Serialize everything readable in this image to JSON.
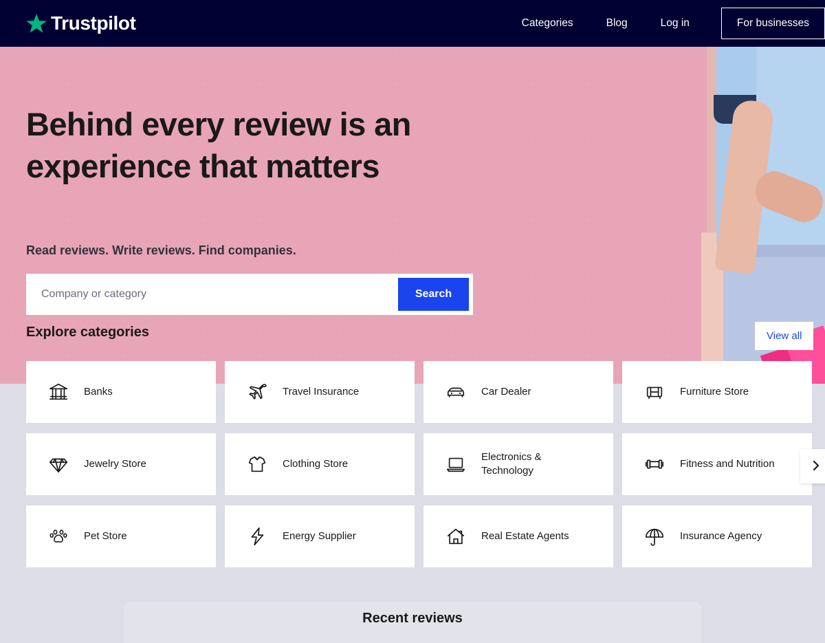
{
  "header": {
    "logo_text": "Trustpilot",
    "logo_icon": "star-icon",
    "nav_links": [
      {
        "label": "Categories",
        "name": "nav-link-categories"
      },
      {
        "label": "Blog",
        "name": "nav-link-blog"
      },
      {
        "label": "Log in",
        "name": "nav-link-login"
      }
    ],
    "business_button": "For businesses",
    "background_color": "#000032",
    "star_color": "#00b67a"
  },
  "hero": {
    "title": "Behind every review is an experience that matters",
    "subtitle": "Read reviews. Write reviews. Find companies.",
    "background_color": "#e8a5b7",
    "search": {
      "placeholder": "Company or category",
      "value": "",
      "button_label": "Search",
      "button_color": "#1a44ee"
    }
  },
  "explore": {
    "heading": "Explore categories",
    "view_all_label": "View all",
    "view_all_color": "#1a44ee",
    "next_arrow_icon": "chevron-right-icon",
    "categories": [
      {
        "label": "Banks",
        "icon": "bank-icon"
      },
      {
        "label": "Travel Insurance",
        "icon": "airplane-icon"
      },
      {
        "label": "Car Dealer",
        "icon": "car-icon"
      },
      {
        "label": "Furniture Store",
        "icon": "armchair-icon"
      },
      {
        "label": "Jewelry Store",
        "icon": "diamond-icon"
      },
      {
        "label": "Clothing Store",
        "icon": "tshirt-icon"
      },
      {
        "label": "Electronics & Technology",
        "icon": "laptop-icon"
      },
      {
        "label": "Fitness and Nutrition",
        "icon": "dumbbell-icon"
      },
      {
        "label": "Pet Store",
        "icon": "paw-icon"
      },
      {
        "label": "Energy Supplier",
        "icon": "lightning-bolt-icon"
      },
      {
        "label": "Real Estate Agents",
        "icon": "house-icon"
      },
      {
        "label": "Insurance Agency",
        "icon": "umbrella-icon"
      }
    ]
  },
  "reviews": {
    "heading": "Recent reviews"
  }
}
